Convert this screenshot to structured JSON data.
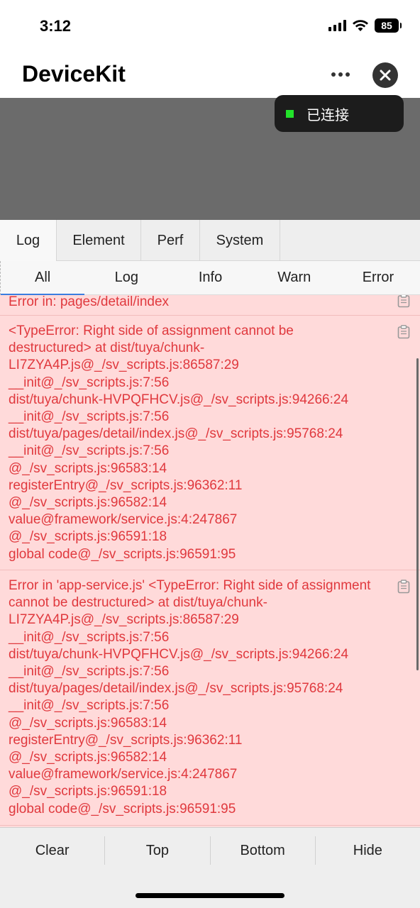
{
  "status": {
    "time": "3:12",
    "battery": "85"
  },
  "nav": {
    "title": "DeviceKit"
  },
  "connection": {
    "label": "已连接",
    "color": "#22e22a"
  },
  "top_tabs": [
    {
      "label": "Log",
      "active": true
    },
    {
      "label": "Element",
      "active": false
    },
    {
      "label": "Perf",
      "active": false
    },
    {
      "label": "System",
      "active": false
    }
  ],
  "sub_tabs": [
    {
      "label": "All",
      "active": true
    },
    {
      "label": "Log",
      "active": false
    },
    {
      "label": "Info",
      "active": false
    },
    {
      "label": "Warn",
      "active": false
    },
    {
      "label": "Error",
      "active": false
    }
  ],
  "logs": [
    {
      "message": "Error in: pages/detail/index"
    },
    {
      "message": "<TypeError: Right side of assignment cannot be\ndestructured> at dist/tuya/chunk-\nLI7ZYA4P.js@_/sv_scripts.js:86587:29\n__init@_/sv_scripts.js:7:56\ndist/tuya/chunk-HVPQFHCV.js@_/sv_scripts.js:94266:24\n__init@_/sv_scripts.js:7:56\ndist/tuya/pages/detail/index.js@_/sv_scripts.js:95768:24\n__init@_/sv_scripts.js:7:56\n@_/sv_scripts.js:96583:14\nregisterEntry@_/sv_scripts.js:96362:11\n@_/sv_scripts.js:96582:14\nvalue@framework/service.js:4:247867\n@_/sv_scripts.js:96591:18\nglobal code@_/sv_scripts.js:96591:95"
    },
    {
      "message": "Error in 'app-service.js' <TypeError: Right side of assignment\ncannot be destructured> at dist/tuya/chunk-\nLI7ZYA4P.js@_/sv_scripts.js:86587:29\n__init@_/sv_scripts.js:7:56\ndist/tuya/chunk-HVPQFHCV.js@_/sv_scripts.js:94266:24\n__init@_/sv_scripts.js:7:56\ndist/tuya/pages/detail/index.js@_/sv_scripts.js:95768:24\n__init@_/sv_scripts.js:7:56\n@_/sv_scripts.js:96583:14\nregisterEntry@_/sv_scripts.js:96362:11\n@_/sv_scripts.js:96582:14\nvalue@framework/service.js:4:247867\n@_/sv_scripts.js:96591:18\nglobal code@_/sv_scripts.js:96591:95"
    }
  ],
  "toolbar": {
    "clear": "Clear",
    "top": "Top",
    "bottom": "Bottom",
    "hide": "Hide"
  },
  "icons": {
    "more": "more-horizontal-icon",
    "close": "close-icon",
    "copy": "clipboard-icon"
  },
  "colors": {
    "error_text": "#e0393e",
    "error_bg": "#ffdada",
    "tab_underline": "#3a7de0"
  }
}
